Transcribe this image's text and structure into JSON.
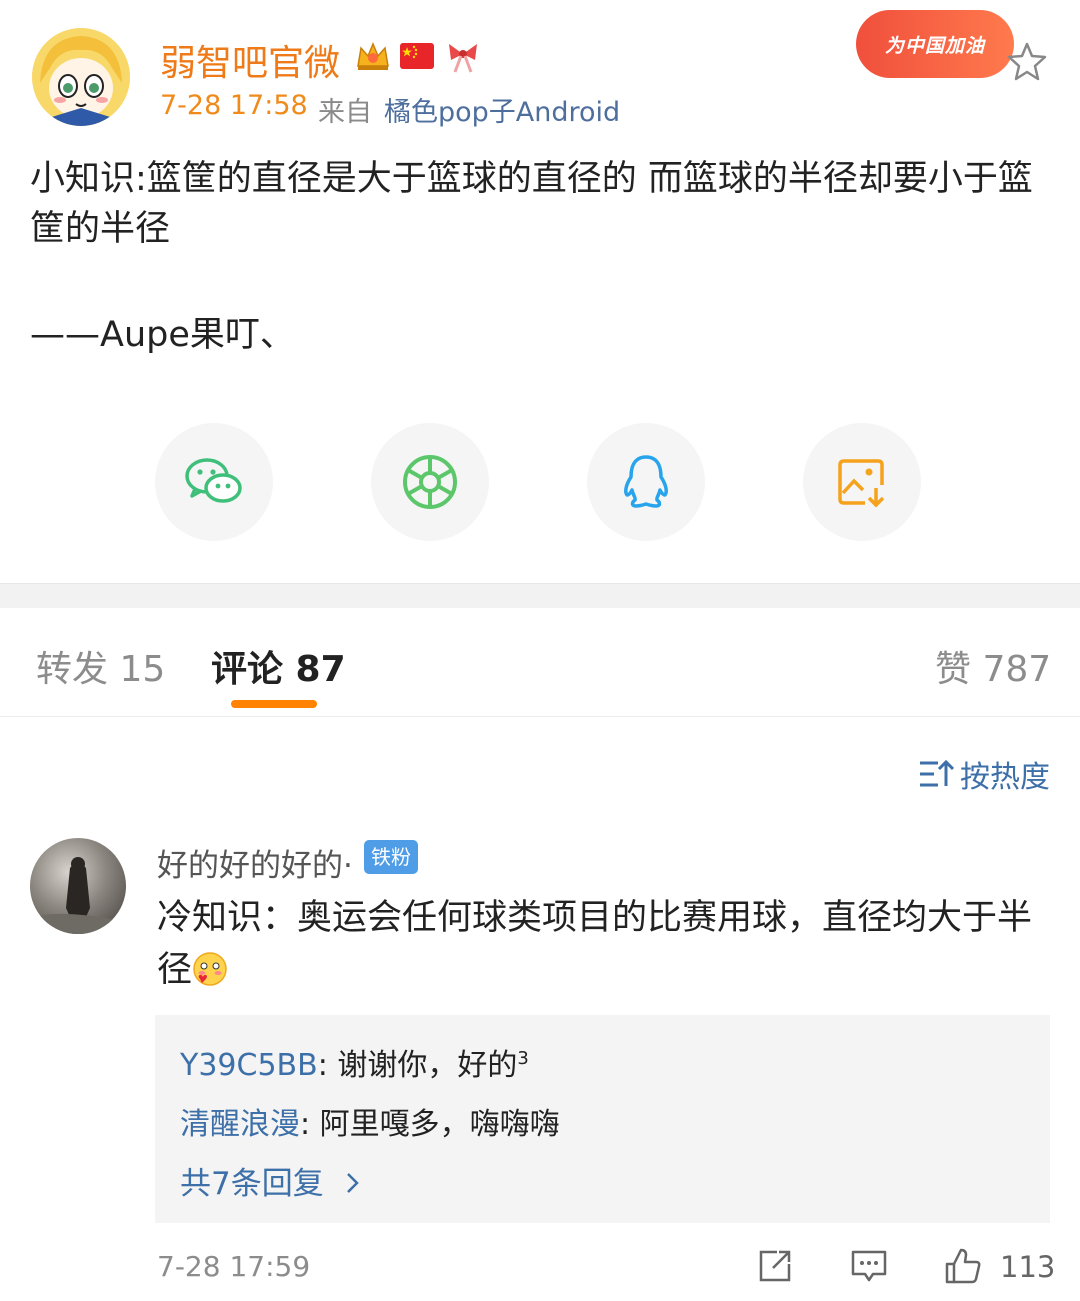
{
  "post": {
    "username": "弱智吧官微",
    "time": "7-28 17:58",
    "from_label": "来自",
    "source": "橘色pop子Android",
    "promo": "为中国加油",
    "text": "小知识:篮筐的直径是大于篮球的直径的 而篮球的半径却要小于篮筐的半径",
    "author": "——Aupe果叮、",
    "share_icons": [
      "wechat-icon",
      "moments-icon",
      "qq-icon",
      "save-image-icon"
    ]
  },
  "tabs": {
    "repost": "转发 15",
    "comment": "评论 87",
    "like": "赞 787"
  },
  "sort": {
    "label": "按热度"
  },
  "comment": {
    "user": "好的好的好的·",
    "badge": "铁粉",
    "text": "冷知识：奥运会任何球类项目的比赛用球，直径均大于半径",
    "replies": [
      {
        "name": "Y39C5BB",
        "text": ": 谢谢你，好的",
        "sup": "3"
      },
      {
        "name": "清醒浪漫",
        "text": ": 阿里嘎多，嗨嗨嗨"
      }
    ],
    "more_replies": "共7条回复",
    "more_icon": "chevron-right-icon",
    "time": "7-28 17:59",
    "like_count": "113"
  },
  "colors": {
    "username": "#ef7a18",
    "link": "#3d6fa8",
    "accent": "#ff8200",
    "fan_badge": "#4f9de6"
  }
}
